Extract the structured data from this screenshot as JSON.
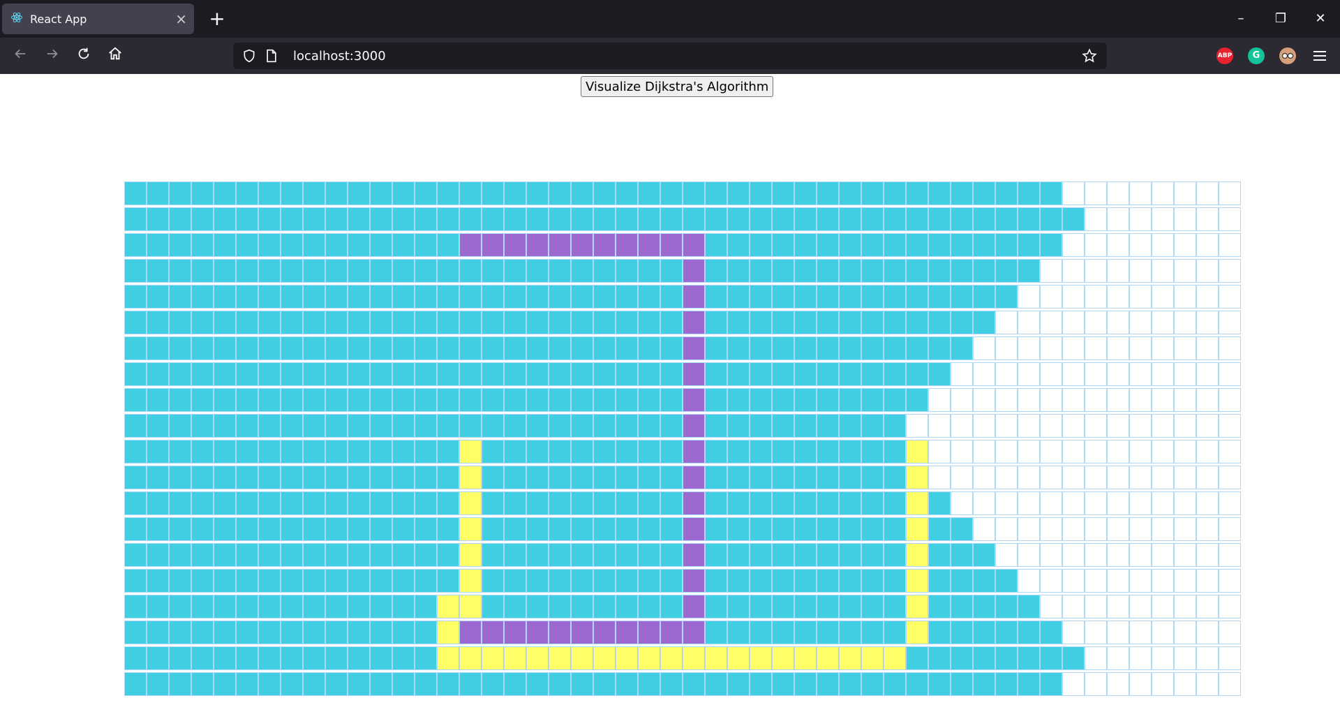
{
  "browser": {
    "tab_title": "React App",
    "tab_close": "×",
    "new_tab": "+",
    "url": "localhost:3000",
    "window_controls": {
      "minimize": "–",
      "restore": "❐",
      "close": "✕"
    },
    "nav_icons": [
      "back-arrow-icon",
      "forward-arrow-icon",
      "reload-icon",
      "home-icon"
    ],
    "extensions": [
      {
        "name": "adblock-plus-icon",
        "label": "ABP",
        "color": "#e8222f"
      },
      {
        "name": "grammarly-icon",
        "label": "G",
        "color": "#15c39a"
      },
      {
        "name": "profile-extension-icon",
        "label": "",
        "color": "#d7a07a"
      }
    ]
  },
  "page": {
    "visualize_button_label": "Visualize Dijkstra's Algorithm"
  },
  "colors": {
    "visited": "#40cee3",
    "wall": "#9b69cf",
    "shortest_path": "#ffff66",
    "unvisited": "#ffffff",
    "node_border": "#afd8f8"
  },
  "grid": {
    "legend": "v = visited, w = wall, p = shortest path, . = unvisited",
    "rows": [
      "vvvvvvvvvvvvvvvvvvvvvvvvvvvvvvvvvvvvvvvvvv........",
      "vvvvvvvvvvvvvvvvvvvvvvvvvvvvvvvvvvvvvvvvvvv.......",
      "vvvvvvvvvvvvvvvwwwwwwwwwwwvvvvvvvvvvvvvvvv........",
      "vvvvvvvvvvvvvvvvvvvvvvvvvwvvvvvvvvvvvvvvv.........",
      "vvvvvvvvvvvvvvvvvvvvvvvvvwvvvvvvvvvvvvvv..........",
      "vvvvvvvvvvvvvvvvvvvvvvvvvwvvvvvvvvvvvvv...........",
      "vvvvvvvvvvvvvvvvvvvvvvvvvwvvvvvvvvvvvv............",
      "vvvvvvvvvvvvvvvvvvvvvvvvvwvvvvvvvvvvv.............",
      "vvvvvvvvvvvvvvvvvvvvvvvvvwvvvvvvvvvv..............",
      "vvvvvvvvvvvvvvvvvvvvvvvvvwvvvvvvvvv...............",
      "vvvvvvvvvvvvvvvpvvvvvvvvvwvvvvvvvvvp..............",
      "vvvvvvvvvvvvvvvpvvvvvvvvvwvvvvvvvvvp..............",
      "vvvvvvvvvvvvvvvpvvvvvvvvvwvvvvvvvvvpv.............",
      "vvvvvvvvvvvvvvvpvvvvvvvvvwvvvvvvvvvpvv............",
      "vvvvvvvvvvvvvvvpvvvvvvvvvwvvvvvvvvvpvvv...........",
      "vvvvvvvvvvvvvvvpvvvvvvvvvwvvvvvvvvvpvvvv..........",
      "vvvvvvvvvvvvvvppvvvvvvvvvwvvvvvvvvvpvvvvv.........",
      "vvvvvvvvvvvvvvpwwwwwwwwwwwvvvvvvvvvpvvvvvv........",
      "vvvvvvvvvvvvvvpppppppppppppppppppppvvvvvvvv.......",
      "vvvvvvvvvvvvvvvvvvvvvvvvvvvvvvvvvvvvvvvvvv........"
    ]
  }
}
